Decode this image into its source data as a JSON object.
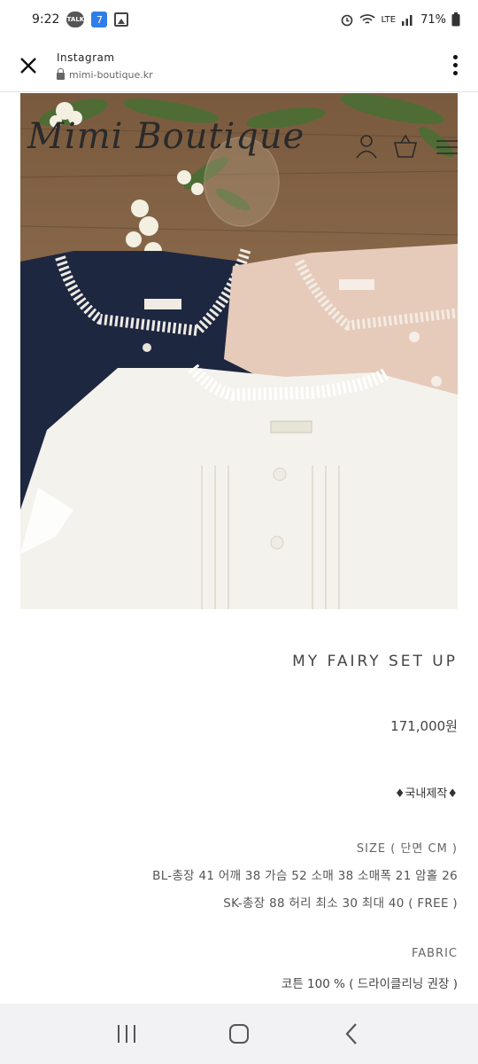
{
  "status_bar": {
    "time": "9:22",
    "talk_badge": "TALK",
    "app_badge": "7",
    "network": "LTE",
    "battery": "71%"
  },
  "browser": {
    "site_name": "Instagram",
    "url": "mimi-boutique.kr"
  },
  "image": {
    "logo": "Mimi Boutique"
  },
  "product": {
    "title": "MY FAIRY SET UP",
    "price": "171,000원",
    "origin": "♦국내제작♦",
    "size_heading": "SIZE ( 단면 CM )",
    "size_bl": "BL-총장 41 어깨 38 가슴 52 소매 38 소매폭 21 암홀 26",
    "size_sk": "SK-총장 88 허리 최소 30 최대 40 ( FREE )",
    "fabric_heading": "FABRIC",
    "fabric_value": "코튼 100 % ( 드라이클리닝 권장 )"
  },
  "icons": [
    "close-icon",
    "lock-icon",
    "more-vert-icon",
    "user-icon",
    "cart-icon",
    "hamburger-icon",
    "recents-icon",
    "home-icon",
    "back-icon"
  ]
}
